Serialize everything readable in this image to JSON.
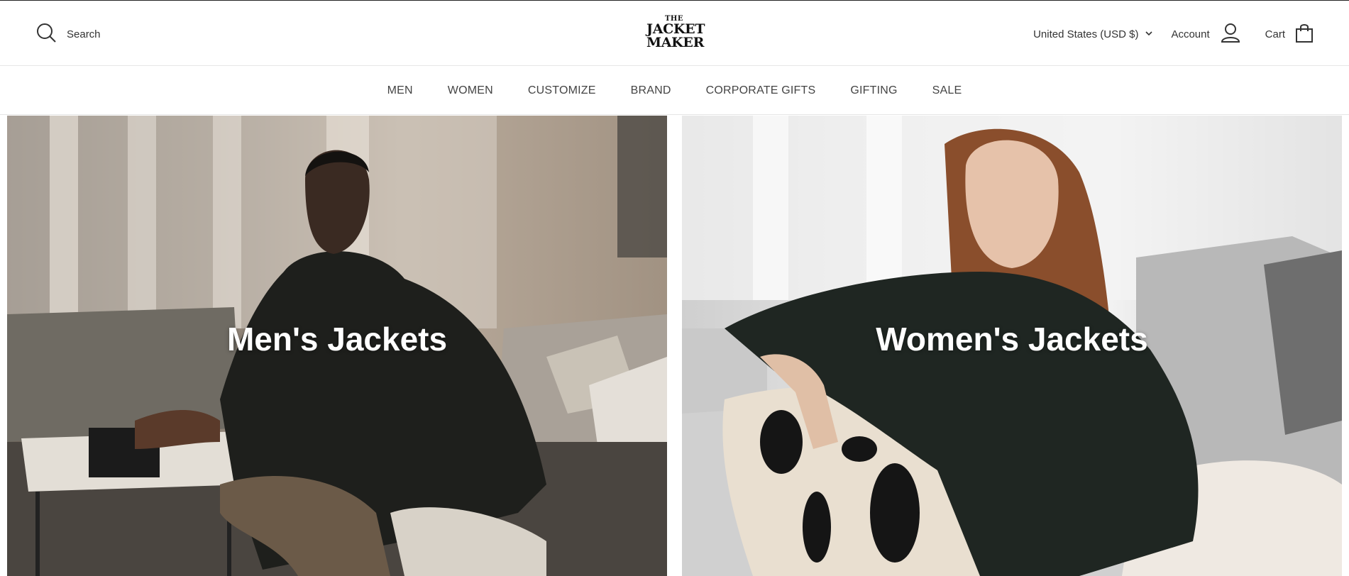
{
  "header": {
    "search_label": "Search",
    "logo": {
      "line1": "THE",
      "line2": "JACKET",
      "line3": "MAKER"
    },
    "currency": "United States (USD $)",
    "account_label": "Account",
    "cart_label": "Cart"
  },
  "nav": {
    "items": [
      "MEN",
      "WOMEN",
      "CUSTOMIZE",
      "BRAND",
      "CORPORATE GIFTS",
      "GIFTING",
      "SALE"
    ]
  },
  "hero": {
    "men_caption": "Men's Jackets",
    "women_caption": "Women's Jackets"
  },
  "icons": {
    "search": "search-icon",
    "account": "user-icon",
    "cart": "shopping-bag-icon",
    "currency_dropdown": "chevron-down-icon"
  },
  "colors": {
    "text": "#333333",
    "caption": "#ffffff",
    "divider": "#e6e6e6"
  }
}
